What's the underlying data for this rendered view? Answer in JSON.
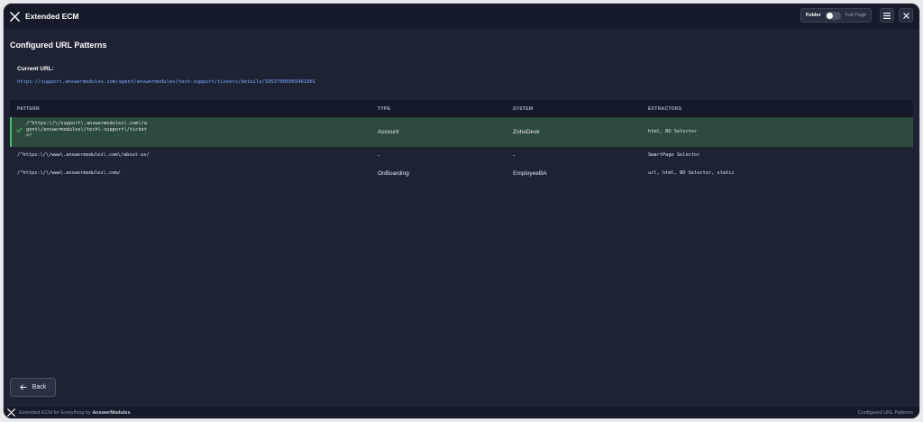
{
  "header": {
    "app_title": "Extended ECM",
    "toggle_left": "Folder",
    "toggle_right": "Full Page",
    "menu_icon": "hamburger-menu-icon",
    "close_icon": "close-icon"
  },
  "main": {
    "page_title": "Configured URL Patterns",
    "current_url_label": "Current URL:",
    "current_url": "https://support.answermodules.com/agent/answermodules/tech-support/tickets/details/59537000065961001"
  },
  "table": {
    "columns": [
      "PATTERN",
      "TYPE",
      "SYSTEM",
      "EXTRACTORS"
    ],
    "rows": [
      {
        "pattern_lines": [
          "/^https:\\/\\/support\\.answermodules\\.com\\/a",
          "gent\\/answermodules\\/tech\\-support\\/ticket",
          "s/"
        ],
        "type": "Account",
        "system": "ZohoDesk",
        "extractors": "html, BO Selector",
        "selected": true
      },
      {
        "pattern_lines": [
          "/^https:\\/\\/www\\.answermodules\\.com\\/about-us/"
        ],
        "type": "-",
        "system": "-",
        "extractors": "SmartPage Selector",
        "selected": false
      },
      {
        "pattern_lines": [
          "/^https:\\/\\/www\\.answermodules\\.com/"
        ],
        "type": "OnBoarding",
        "system": "EmployeeBA",
        "extractors": "url, html, BO Selector, static",
        "selected": false
      }
    ]
  },
  "back_button": {
    "label": "Back",
    "icon": "arrow-left-icon"
  },
  "footer": {
    "left_prefix": "Extended ECM for Everything by",
    "left_brand": "AnswerModules",
    "right": "Configured URL Patterns"
  },
  "colors": {
    "background": "#1d2333",
    "accent_green": "#4fbf63",
    "selected_row": "#2c4a3d",
    "link": "#7ea8ff"
  }
}
